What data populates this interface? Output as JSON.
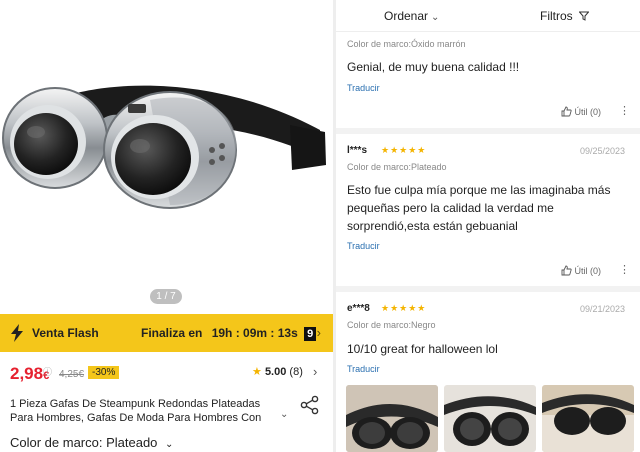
{
  "product": {
    "image_counter": "1 / 7",
    "flash": {
      "label": "Venta Flash",
      "ends_prefix": "Finaliza en",
      "countdown": "19h : 09m : 13s",
      "seconds_box": "9"
    },
    "price_main": "2,98",
    "price_currency": "€",
    "price_info_glyph": "ⓘ",
    "old_price": "4,25€",
    "discount": "-30%",
    "rating_value": "5.00",
    "rating_count": "(8)",
    "title": "1 Pieza Gafas De Steampunk Redondas Plateadas Para Hombres, Gafas De Moda Para Hombres Con",
    "color_label": "Color de marco: Plateado"
  },
  "reviews_header": {
    "sort_label": "Ordenar",
    "filter_label": "Filtros"
  },
  "reviews": [
    {
      "user": "",
      "stars": "",
      "date": "",
      "color": "Color de marco:Óxido marrón",
      "text": "Genial, de muy buena calidad !!!",
      "translate": "Traducir",
      "useful": "Útil (0)"
    },
    {
      "user": "l***s",
      "stars": "★★★★★",
      "date": "09/25/2023",
      "color": "Color de marco:Plateado",
      "text": "Esto fue culpa mía porque me las imaginaba más pequeñas pero la calidad la verdad me sorprendió,esta están gebuanial",
      "translate": "Traducir",
      "useful": "Útil (0)"
    },
    {
      "user": "e***8",
      "stars": "★★★★★",
      "date": "09/21/2023",
      "color": "Color de marco:Negro",
      "text": "10/10 great for halloween lol",
      "translate": "Traducir",
      "useful": ""
    }
  ],
  "icons": {
    "flash": "lightning-bolt-icon",
    "share": "share-icon",
    "thumbs_up": "thumbs-up-icon",
    "more": "more-dots-icon",
    "filter": "funnel-icon",
    "chevron": "chevron-icon"
  },
  "colors": {
    "accent_yellow": "#f4c61a",
    "price_red": "#e6212f",
    "link_blue": "#2a6fb0",
    "star_gold": "#f4b400"
  }
}
